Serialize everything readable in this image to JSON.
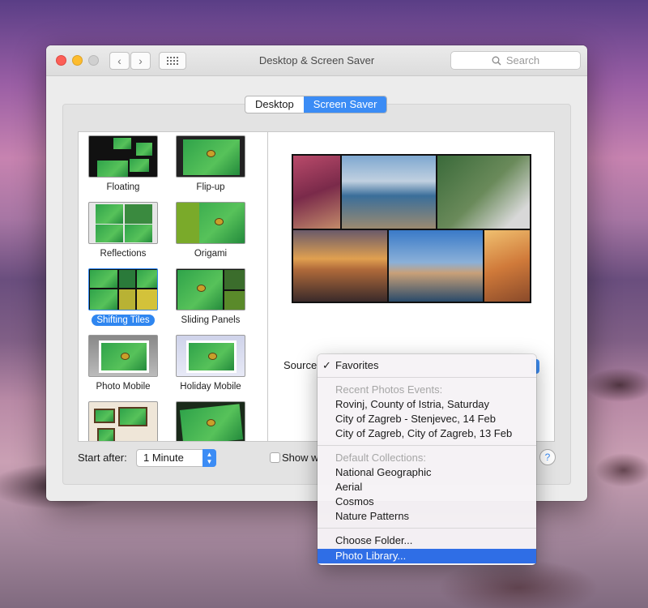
{
  "window": {
    "title": "Desktop & Screen Saver",
    "search_placeholder": "Search"
  },
  "tabs": [
    {
      "label": "Desktop",
      "selected": false
    },
    {
      "label": "Screen Saver",
      "selected": true
    }
  ],
  "screensavers": [
    {
      "label": "Floating",
      "selected": false
    },
    {
      "label": "Flip-up",
      "selected": false
    },
    {
      "label": "Reflections",
      "selected": false
    },
    {
      "label": "Origami",
      "selected": false
    },
    {
      "label": "Shifting Tiles",
      "selected": true
    },
    {
      "label": "Sliding Panels",
      "selected": false
    },
    {
      "label": "Photo Mobile",
      "selected": false
    },
    {
      "label": "Holiday Mobile",
      "selected": false
    }
  ],
  "controls": {
    "source_label": "Source",
    "start_after_label": "Start after:",
    "start_after_value": "1 Minute",
    "show_with_clock_partial": "Show w",
    "help_label": "?"
  },
  "source_menu": {
    "selected": "Favorites",
    "check_glyph": "✓",
    "recent_header": "Recent Photos Events:",
    "recent_items": [
      "Rovinj, County of Istria, Saturday",
      "City of Zagreb - Stenjevec, 14 Feb",
      "City of Zagreb, City of Zagreb, 13 Feb"
    ],
    "default_header": "Default Collections:",
    "default_items": [
      "National Geographic",
      "Aerial",
      "Cosmos",
      "Nature Patterns"
    ],
    "choose_folder": "Choose Folder...",
    "photo_library": "Photo Library..."
  },
  "colors": {
    "accent": "#2f6ee6",
    "segment_selected": "#3b8cf5"
  }
}
